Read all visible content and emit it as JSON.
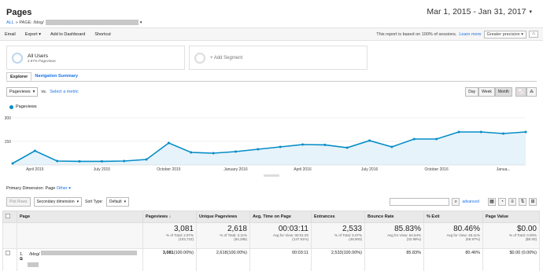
{
  "header": {
    "title": "Pages",
    "crumb_all": "ALL",
    "crumb_path": "» PAGE: /blog/",
    "date_range": "Mar 1, 2015 - Jan 31, 2017"
  },
  "toolbar": {
    "email": "Email",
    "export": "Export",
    "add_dashboard": "Add to Dashboard",
    "shortcut": "Shortcut",
    "sessions_note": "This report is based on 100% of sessions.",
    "learn_more": "Learn more",
    "precision": "Greater precision"
  },
  "segments": {
    "all_users": "All Users",
    "all_users_pct": "2.97% Pageviews",
    "add_segment": "+ Add Segment"
  },
  "tabs": [
    "Explorer",
    "Navigation Summary"
  ],
  "controls": {
    "metric": "Pageviews",
    "vs": "vs.",
    "select_metric": "Select a metric",
    "day": "Day",
    "week": "Week",
    "month": "Month"
  },
  "chart_data": {
    "type": "line",
    "series": [
      {
        "name": "Pageviews",
        "values": [
          10,
          90,
          25,
          23,
          23,
          25,
          35,
          140,
          80,
          75,
          85,
          100,
          115,
          130,
          128,
          110,
          155,
          115,
          165,
          165,
          210,
          210,
          200,
          210
        ]
      }
    ],
    "ylim": [
      0,
      300
    ],
    "y_ticks": [
      "300",
      "150"
    ],
    "x_tick_labels": [
      "April 2015",
      "July 2015",
      "October 2015",
      "January 2016",
      "April 2016",
      "July 2016",
      "October 2016",
      "Janua..."
    ],
    "grid": true,
    "color": "#058dc7",
    "fill": "#e6f3fa"
  },
  "primary_dim": {
    "label": "Primary Dimension:",
    "value": "Page",
    "other": "Other"
  },
  "table_controls": {
    "plot_rows": "Plot Rows",
    "secondary": "Secondary dimension",
    "sort_type": "Sort Type:",
    "sort_value": "Default",
    "advanced": "advanced"
  },
  "table": {
    "headers": [
      "Page",
      "Pageviews",
      "Unique Pageviews",
      "Avg. Time on Page",
      "Entrances",
      "Bounce Rate",
      "% Exit",
      "Page Value"
    ],
    "totals": [
      {
        "big": "3,081",
        "small1": "% of Total: 2.97%",
        "small2": "(103,722)"
      },
      {
        "big": "2,618",
        "small1": "% of Total: 3.11%",
        "small2": "(84,286)"
      },
      {
        "big": "00:03:11",
        "small1": "Avg for View: 00:01:20",
        "small2": "(137.81%)"
      },
      {
        "big": "2,533",
        "small1": "% of Total: 5.07%",
        "small2": "(49,903)"
      },
      {
        "big": "85.83%",
        "small1": "Avg for View: 64.54%",
        "small2": "(32.99%)"
      },
      {
        "big": "80.46%",
        "small1": "Avg for View: 48.11%",
        "small2": "(66.97%)"
      },
      {
        "big": "$0.00",
        "small1": "% of Total: 0.00%",
        "small2": "($0.00)"
      }
    ],
    "row": {
      "index": "1.",
      "page": "/blog/",
      "pageviews": "3,081",
      "pageviews_pct": "(100.00%)",
      "unique": "2,618",
      "unique_pct": "(100.00%)",
      "avg_time": "00:03:11",
      "entrances": "2,533",
      "entrances_pct": "(100.00%)",
      "bounce": "85.83%",
      "exit": "80.46%",
      "value": "$0.00",
      "value_pct": "(0.00%)"
    }
  }
}
